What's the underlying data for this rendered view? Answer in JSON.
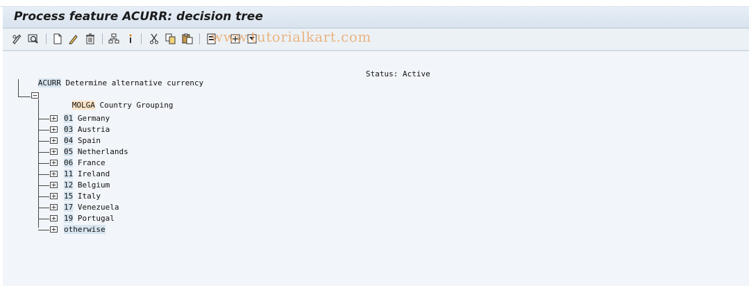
{
  "title": "Process feature ACURR: decision tree",
  "watermark": "www.tutorialkart.com",
  "toolbar": {
    "buttons": [
      {
        "name": "change-icon"
      },
      {
        "name": "display-icon"
      },
      {
        "name": "create-icon"
      },
      {
        "name": "edit-icon"
      },
      {
        "name": "delete-icon"
      },
      {
        "name": "structure-icon"
      },
      {
        "name": "info-icon"
      },
      {
        "name": "cut-icon"
      },
      {
        "name": "copy-icon"
      },
      {
        "name": "paste-icon"
      },
      {
        "name": "expand-icon"
      },
      {
        "name": "insert-icon"
      },
      {
        "name": "collapse-icon"
      }
    ]
  },
  "tree": {
    "root": {
      "key": "ACURR",
      "text": "Determine alternative currency"
    },
    "status": "Status: Active",
    "decision": {
      "key": "MOLGA",
      "text": "Country Grouping"
    },
    "nodes": [
      {
        "key": "01",
        "text": "Germany"
      },
      {
        "key": "03",
        "text": "Austria"
      },
      {
        "key": "04",
        "text": "Spain"
      },
      {
        "key": "05",
        "text": "Netherlands"
      },
      {
        "key": "06",
        "text": "France"
      },
      {
        "key": "11",
        "text": "Ireland"
      },
      {
        "key": "12",
        "text": "Belgium"
      },
      {
        "key": "15",
        "text": "Italy"
      },
      {
        "key": "17",
        "text": "Venezuela"
      },
      {
        "key": "19",
        "text": "Portugal"
      },
      {
        "key": "otherwise",
        "text": ""
      }
    ]
  },
  "colors": {
    "title_bg": "#dfe8f1",
    "content_bg": "#f2f5f9",
    "key_highlight": "#d7e5ef",
    "decision_highlight": "#fbe3c7",
    "watermark": "#e8a15c"
  }
}
